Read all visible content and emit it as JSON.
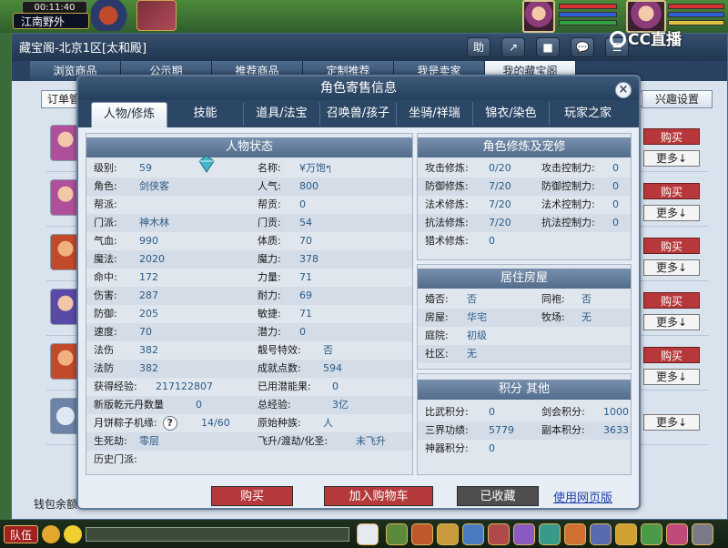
{
  "game": {
    "clock": "00:11:40",
    "location": "江南野外",
    "stream_logo": "CC直播"
  },
  "pavilion": {
    "title": "藏宝阁-北京1区[太和殿]",
    "toolbar": [
      "助",
      "↗",
      "■",
      "💬",
      "☰",
      "✕"
    ],
    "tabs": [
      "浏览商品",
      "公示期",
      "推荐商品",
      "定制推荐",
      "我是卖家",
      "我的藏宝阁"
    ],
    "active_tab": 5,
    "order_label": "订单管",
    "interest_label": "兴趣设置",
    "buy_label": "购买",
    "more_label": "更多↓",
    "wallet_label": "钱包余额"
  },
  "modal": {
    "title": "角色寄售信息",
    "close_icon": "close-icon",
    "tabs": [
      "人物/修炼",
      "技能",
      "道具/法宝",
      "召唤兽/孩子",
      "坐骑/祥瑞",
      "锦衣/染色",
      "玩家之家"
    ],
    "active_tab": 0,
    "status_panel": {
      "title": "人物状态",
      "left": [
        {
          "k": "级别:",
          "v": "59"
        },
        {
          "k": "角色:",
          "v": "剑侠客"
        },
        {
          "k": "帮派:",
          "v": ""
        },
        {
          "k": "门派:",
          "v": "神木林"
        },
        {
          "k": "气血:",
          "v": "990"
        },
        {
          "k": "魔法:",
          "v": "2020"
        },
        {
          "k": "命中:",
          "v": "172"
        },
        {
          "k": "伤害:",
          "v": "287"
        },
        {
          "k": "防御:",
          "v": "205"
        },
        {
          "k": "速度:",
          "v": "70"
        },
        {
          "k": "法伤",
          "v": "382"
        },
        {
          "k": "法防",
          "v": "382"
        },
        {
          "k": "获得经验:",
          "v": "217122807"
        },
        {
          "k": "新版乾元丹数量",
          "v": "0"
        },
        {
          "k": "月饼粽子机缘:",
          "v": "14/60"
        },
        {
          "k": "生死劫:",
          "v": "零层"
        },
        {
          "k": "历史门派:",
          "v": ""
        }
      ],
      "right": [
        {
          "k": "名称:",
          "v": "¥万饱ๆ"
        },
        {
          "k": "人气:",
          "v": "800"
        },
        {
          "k": "帮贡:",
          "v": "0"
        },
        {
          "k": "门贡:",
          "v": "54"
        },
        {
          "k": "体质:",
          "v": "70"
        },
        {
          "k": "魔力:",
          "v": "378"
        },
        {
          "k": "力量:",
          "v": "71"
        },
        {
          "k": "耐力:",
          "v": "69"
        },
        {
          "k": "敏捷:",
          "v": "71"
        },
        {
          "k": "潜力:",
          "v": "0"
        },
        {
          "k": "靓号特效:",
          "v": "否"
        },
        {
          "k": "成就点数:",
          "v": "594"
        },
        {
          "k": "已用潜能果:",
          "v": "0"
        },
        {
          "k": "总经验:",
          "v": "3亿"
        },
        {
          "k": "原始种族:",
          "v": "人"
        },
        {
          "k": "飞升/渡劫/化圣:",
          "v": "未飞升"
        }
      ],
      "help_icon": "?"
    },
    "cultivation_panel": {
      "title": "角色修炼及宠修",
      "rows": [
        {
          "k1": "攻击修炼:",
          "v1": "0/20",
          "k2": "攻击控制力:",
          "v2": "0"
        },
        {
          "k1": "防御修炼:",
          "v1": "7/20",
          "k2": "防御控制力:",
          "v2": "0"
        },
        {
          "k1": "法术修炼:",
          "v1": "7/20",
          "k2": "法术控制力:",
          "v2": "0"
        },
        {
          "k1": "抗法修炼:",
          "v1": "7/20",
          "k2": "抗法控制力:",
          "v2": "0"
        },
        {
          "k1": "猎术修炼:",
          "v1": "0",
          "k2": "",
          "v2": ""
        }
      ]
    },
    "house_panel": {
      "title": "居住房屋",
      "rows": [
        {
          "k1": "婚否:",
          "v1": "否",
          "k2": "同袍:",
          "v2": "否"
        },
        {
          "k1": "房屋:",
          "v1": "华宅",
          "k2": "牧场:",
          "v2": "无"
        },
        {
          "k1": "庭院:",
          "v1": "初级",
          "k2": "",
          "v2": ""
        },
        {
          "k1": "社区:",
          "v1": "无",
          "k2": "",
          "v2": ""
        }
      ]
    },
    "points_panel": {
      "title": "积分 其他",
      "rows": [
        {
          "k1": "比武积分:",
          "v1": "0",
          "k2": "剑会积分:",
          "v2": "1000"
        },
        {
          "k1": "三界功绩:",
          "v1": "5779",
          "k2": "副本积分:",
          "v2": "3633"
        },
        {
          "k1": "神器积分:",
          "v1": "0",
          "k2": "",
          "v2": ""
        }
      ]
    },
    "buttons": {
      "buy": "购买",
      "add_cart": "加入购物车",
      "favorited": "已收藏",
      "web_link": "使用网页版"
    }
  },
  "bottom_bar": {
    "team_label": "队伍"
  },
  "colors": {
    "buy_red": "#b53a3c",
    "value_blue": "#2d5b86",
    "header_blue": "#536c8b",
    "dark_gray_button": "#4e4e4e"
  }
}
